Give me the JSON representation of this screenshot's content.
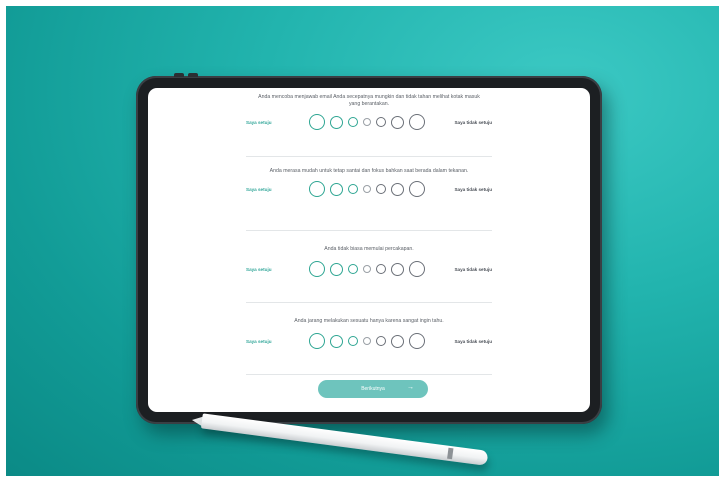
{
  "questions": [
    {
      "text": "Anda mencoba menjawab email Anda secepatnya mungkin dan tidak tahan melihat kotak masuk yang berantakan.",
      "left_label": "Saya setuju",
      "right_label": "Saya tidak setuju"
    },
    {
      "text": "Anda merasa mudah untuk tetap santai dan fokus bahkan saat berada dalam tekanan.",
      "left_label": "Saya setuju",
      "right_label": "Saya tidak setuju"
    },
    {
      "text": "Anda tidak biasa memulai percakapan.",
      "left_label": "Saya setuju",
      "right_label": "Saya tidak setuju"
    },
    {
      "text": "Anda jarang melakukan sesuatu hanya karena sangat ingin tahu.",
      "left_label": "Saya setuju",
      "right_label": "Saya tidak setuju"
    }
  ],
  "next_button": {
    "label": "Berikutnya",
    "icon": "arrow-right-icon",
    "glyph": "→"
  },
  "colors": {
    "background": "#22b4ae",
    "agree": "#2fa693",
    "button": "#6ec4bd"
  }
}
